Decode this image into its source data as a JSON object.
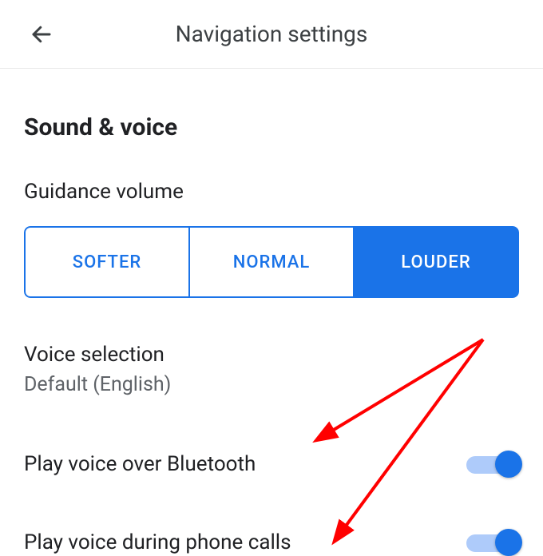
{
  "header": {
    "title": "Navigation settings"
  },
  "section": {
    "title": "Sound & voice"
  },
  "guidance": {
    "label": "Guidance volume",
    "options": {
      "softer": "SOFTER",
      "normal": "NORMAL",
      "louder": "LOUDER"
    },
    "selected": "louder"
  },
  "voice_selection": {
    "label": "Voice selection",
    "value": "Default (English)"
  },
  "bluetooth": {
    "label": "Play voice over Bluetooth",
    "enabled": true
  },
  "phone_calls": {
    "label": "Play voice during phone calls",
    "enabled": true
  }
}
